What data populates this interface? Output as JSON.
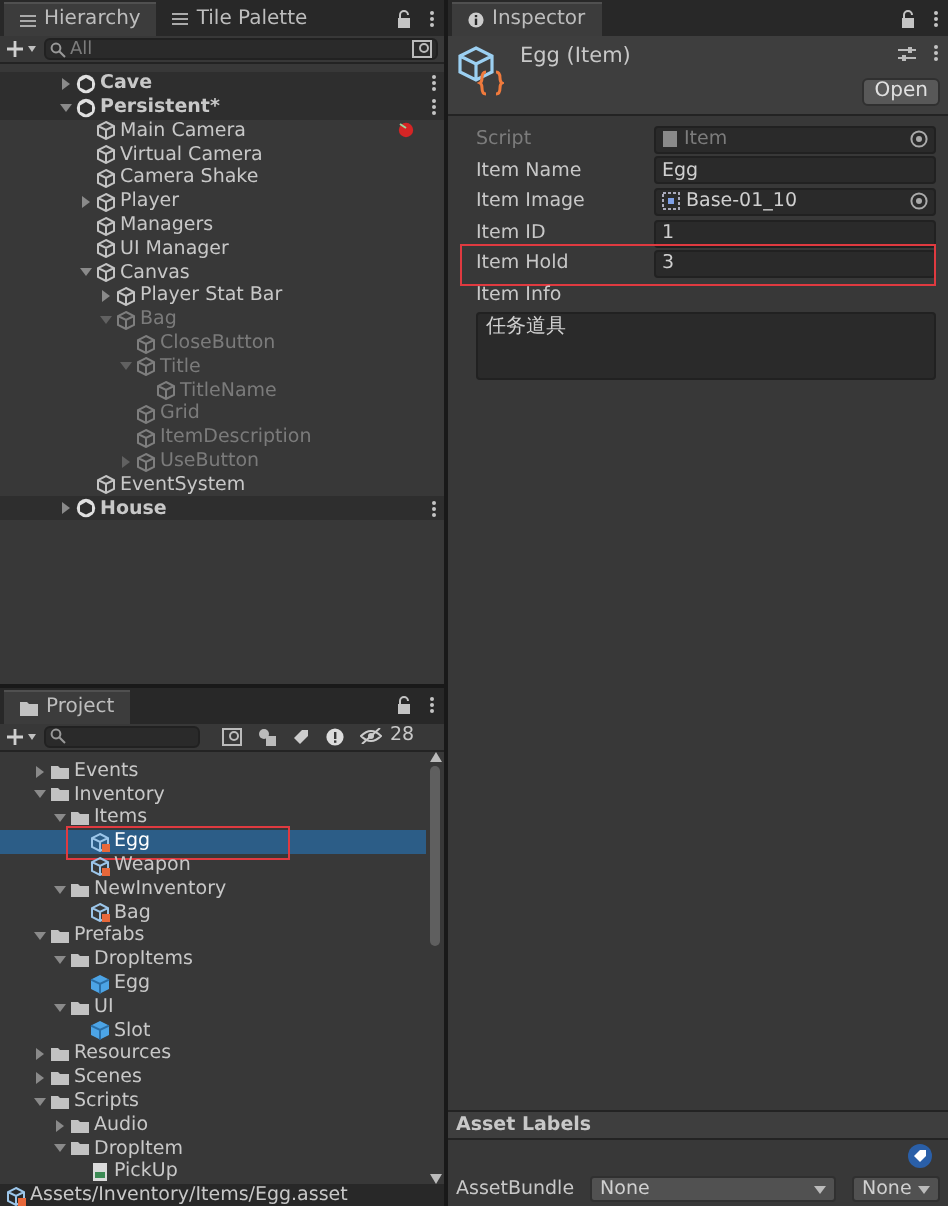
{
  "hierarchy": {
    "tabs": [
      {
        "label": "Hierarchy",
        "selected": true
      },
      {
        "label": "Tile Palette",
        "selected": false
      }
    ],
    "search": {
      "placeholder": "All"
    },
    "items": [
      {
        "label": "Cave",
        "kind": "scene",
        "expanded": false,
        "active": true
      },
      {
        "label": "Persistent*",
        "kind": "scene",
        "expanded": true,
        "active": true,
        "children": [
          {
            "label": "Main Camera",
            "kind": "object",
            "active": true,
            "gizmo": true
          },
          {
            "label": "Virtual Camera",
            "kind": "object",
            "active": true
          },
          {
            "label": "Camera Shake",
            "kind": "object",
            "active": true
          },
          {
            "label": "Player",
            "kind": "object",
            "expanded": false,
            "active": true
          },
          {
            "label": "Managers",
            "kind": "object",
            "active": true
          },
          {
            "label": "UI Manager",
            "kind": "object",
            "active": true
          },
          {
            "label": "Canvas",
            "kind": "object",
            "expanded": true,
            "active": true,
            "children": [
              {
                "label": "Player Stat Bar",
                "kind": "object",
                "expanded": false,
                "active": true
              },
              {
                "label": "Bag",
                "kind": "object",
                "expanded": true,
                "active": false,
                "children": [
                  {
                    "label": "CloseButton",
                    "kind": "object",
                    "active": false
                  },
                  {
                    "label": "Title",
                    "kind": "object",
                    "expanded": true,
                    "active": false,
                    "children": [
                      {
                        "label": "TitleName",
                        "kind": "object",
                        "active": false
                      }
                    ]
                  },
                  {
                    "label": "Grid",
                    "kind": "object",
                    "active": false
                  },
                  {
                    "label": "ItemDescription",
                    "kind": "object",
                    "active": false
                  },
                  {
                    "label": "UseButton",
                    "kind": "object",
                    "expanded": false,
                    "active": false
                  }
                ]
              }
            ]
          },
          {
            "label": "EventSystem",
            "kind": "object",
            "active": true
          }
        ]
      },
      {
        "label": "House",
        "kind": "scene",
        "expanded": false,
        "active": true
      }
    ]
  },
  "project": {
    "tabs": [
      {
        "label": "Project",
        "selected": true
      }
    ],
    "hidden_count": "28",
    "items": [
      {
        "label": "Events",
        "kind": "folder",
        "expanded": false
      },
      {
        "label": "Inventory",
        "kind": "folder",
        "expanded": true,
        "children": [
          {
            "label": "Items",
            "kind": "folder",
            "expanded": true,
            "children": [
              {
                "label": "Egg",
                "kind": "asset",
                "selected": true,
                "highlighted": true
              },
              {
                "label": "Weapon",
                "kind": "asset",
                "selected": false,
                "highlighted": false
              }
            ]
          },
          {
            "label": "NewInventory",
            "kind": "folder",
            "expanded": true,
            "children": [
              {
                "label": "Bag",
                "kind": "asset",
                "selected": false,
                "highlighted": false
              }
            ]
          }
        ]
      },
      {
        "label": "Prefabs",
        "kind": "folder",
        "expanded": true,
        "children": [
          {
            "label": "DropItems",
            "kind": "folder",
            "expanded": true,
            "children": [
              {
                "label": "Egg",
                "kind": "prefab"
              }
            ]
          },
          {
            "label": "UI",
            "kind": "folder",
            "expanded": true,
            "children": [
              {
                "label": "Slot",
                "kind": "prefab"
              }
            ]
          }
        ]
      },
      {
        "label": "Resources",
        "kind": "folder",
        "expanded": false
      },
      {
        "label": "Scenes",
        "kind": "folder",
        "expanded": false
      },
      {
        "label": "Scripts",
        "kind": "folder",
        "expanded": true,
        "children": [
          {
            "label": "Audio",
            "kind": "folder",
            "expanded": false
          },
          {
            "label": "DropItem",
            "kind": "folder",
            "expanded": true,
            "children": [
              {
                "label": "PickUp",
                "kind": "script"
              }
            ]
          }
        ]
      }
    ],
    "status_bar": "Assets/Inventory/Items/Egg.asset"
  },
  "inspector": {
    "tabs": [
      {
        "label": "Inspector",
        "selected": true
      }
    ],
    "title": "Egg (Item)",
    "open_button": "Open",
    "properties": [
      {
        "label": "Script",
        "kind": "object",
        "value": "Item",
        "disabled": true,
        "highlighted": false
      },
      {
        "label": "Item Name",
        "kind": "text",
        "value": "Egg",
        "disabled": false,
        "highlighted": false
      },
      {
        "label": "Item Image",
        "kind": "object",
        "value": "Base-01_10",
        "disabled": false,
        "highlighted": false
      },
      {
        "label": "Item ID",
        "kind": "text",
        "value": "1",
        "disabled": false,
        "highlighted": false
      },
      {
        "label": "Item Hold",
        "kind": "text",
        "value": "3",
        "disabled": false,
        "highlighted": true
      },
      {
        "label": "Item Info",
        "kind": "textarea",
        "value": "任务道具",
        "disabled": false,
        "highlighted": false
      }
    ],
    "asset_labels": "Asset Labels",
    "asset_bundle": {
      "label": "AssetBundle",
      "values": [
        "None",
        "None"
      ]
    }
  }
}
